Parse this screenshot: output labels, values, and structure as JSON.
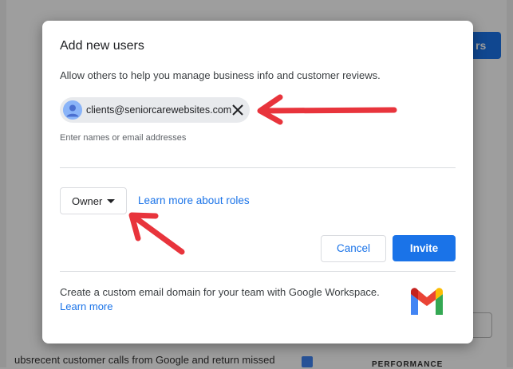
{
  "background": {
    "top_button_label": "rs",
    "bottom_left_text": "ubsrecent customer calls from Google and return missed",
    "bottom_right_text": "PERFORMANCE"
  },
  "dialog": {
    "title": "Add new users",
    "subtitle": "Allow others to help you manage business info and customer reviews.",
    "chip_email": "clients@seniorcarewebsites.com",
    "input_hint": "Enter names or email addresses",
    "role_selected": "Owner",
    "roles_link": "Learn more about roles",
    "cancel_label": "Cancel",
    "invite_label": "Invite",
    "workspace_text": "Create a custom email domain for your team with Google Workspace.",
    "workspace_link": "Learn more"
  },
  "icons": {
    "avatar": "person-avatar-icon",
    "remove": "close-icon",
    "role_caret": "caret-down-icon",
    "gmail": "gmail-logo-icon",
    "annotation": "red-arrow-icon"
  },
  "colors": {
    "accent": "#1a73e8",
    "annotation": "#e8343c",
    "chip_bg": "#e8eaed"
  }
}
